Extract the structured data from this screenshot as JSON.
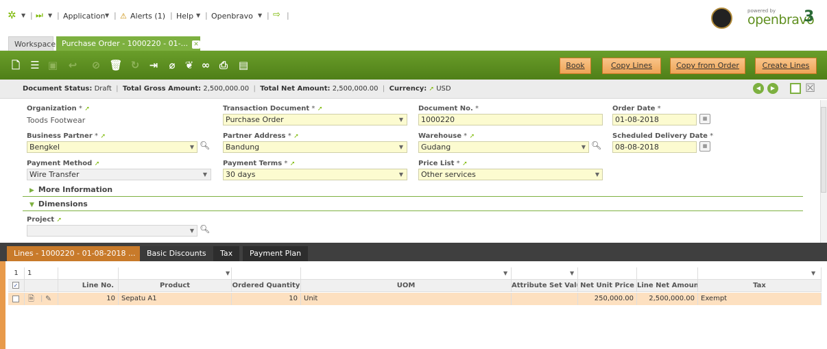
{
  "topnav": {
    "application": "Application",
    "alerts": "Alerts (1)",
    "help": "Help",
    "openbravo": "Openbravo"
  },
  "branding": {
    "powered_by": "powered by",
    "name": "openbravo",
    "version": "3"
  },
  "tabs": {
    "workspace": "Workspace",
    "active": "Purchase Order - 1000220 - 01-..."
  },
  "actions": {
    "book": "Book",
    "copy_lines": "Copy Lines",
    "copy_from_order": "Copy from Order",
    "create_lines": "Create Lines"
  },
  "status": {
    "doc_status_label": "Document Status:",
    "doc_status": "Draft",
    "gross_label": "Total Gross Amount:",
    "gross": "2,500,000.00",
    "net_label": "Total Net Amount:",
    "net": "2,500,000.00",
    "currency_label": "Currency:",
    "currency": "USD"
  },
  "form": {
    "organization": {
      "label": "Organization",
      "value": "Toods Footwear"
    },
    "transaction_document": {
      "label": "Transaction Document",
      "value": "Purchase Order"
    },
    "document_no": {
      "label": "Document No.",
      "value": "1000220"
    },
    "order_date": {
      "label": "Order Date",
      "value": "01-08-2018"
    },
    "business_partner": {
      "label": "Business Partner",
      "value": "Bengkel"
    },
    "partner_address": {
      "label": "Partner Address",
      "value": "Bandung"
    },
    "warehouse": {
      "label": "Warehouse",
      "value": "Gudang"
    },
    "scheduled_delivery_date": {
      "label": "Scheduled Delivery Date",
      "value": "08-08-2018"
    },
    "payment_method": {
      "label": "Payment Method",
      "value": "Wire Transfer"
    },
    "payment_terms": {
      "label": "Payment Terms",
      "value": "30 days"
    },
    "price_list": {
      "label": "Price List",
      "value": "Other services"
    },
    "more_information": "More Information",
    "dimensions": "Dimensions",
    "project": {
      "label": "Project",
      "value": ""
    }
  },
  "lines_tabs": {
    "lines": "Lines - 1000220 - 01-08-2018 ...",
    "basic_discounts": "Basic Discounts",
    "tax": "Tax",
    "payment_plan": "Payment Plan"
  },
  "grid": {
    "filter_count_a": "1",
    "filter_count_b": "1",
    "headers": {
      "line_no": "Line No.",
      "product": "Product",
      "ordered_quantity": "Ordered Quantity",
      "uom": "UOM",
      "attribute_set_value": "Attribute Set Value",
      "net_unit_price": "Net Unit Price",
      "line_net_amount": "Line Net Amount",
      "tax": "Tax"
    },
    "rows": [
      {
        "line_no": "10",
        "product": "Sepatu A1",
        "ordered_quantity": "10",
        "uom": "Unit",
        "attribute_set_value": "",
        "net_unit_price": "250,000.00",
        "line_net_amount": "2,500,000.00",
        "tax": "Exempt"
      }
    ]
  },
  "colors": {
    "brand_green": "#7db040",
    "toolbar_green": "#5a8c1e",
    "action_orange": "#f6b26b",
    "required_yellow": "#fcfbd0"
  }
}
